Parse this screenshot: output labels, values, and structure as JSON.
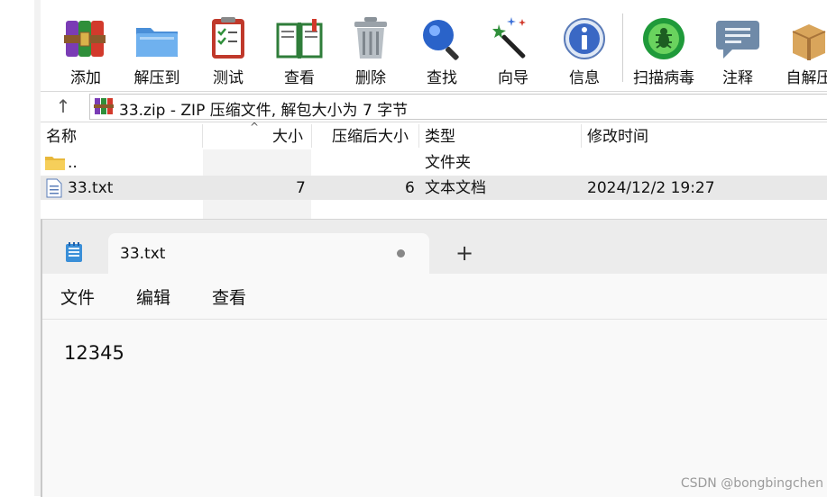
{
  "winrar": {
    "toolbar": [
      {
        "label": "添加",
        "icon": "add-archive-icon"
      },
      {
        "label": "解压到",
        "icon": "extract-to-icon"
      },
      {
        "label": "测试",
        "icon": "test-icon"
      },
      {
        "label": "查看",
        "icon": "view-icon"
      },
      {
        "label": "删除",
        "icon": "delete-icon"
      },
      {
        "label": "查找",
        "icon": "find-icon"
      },
      {
        "label": "向导",
        "icon": "wizard-icon"
      },
      {
        "label": "信息",
        "icon": "info-icon"
      },
      {
        "label": "扫描病毒",
        "icon": "virus-scan-icon"
      },
      {
        "label": "注释",
        "icon": "comment-icon"
      },
      {
        "label": "自解压",
        "icon": "sfx-icon"
      }
    ],
    "path_text": "33.zip - ZIP 压缩文件, 解包大小为 7 字节",
    "columns": {
      "name": "名称",
      "size": "大小",
      "packed": "压缩后大小",
      "type": "类型",
      "modified": "修改时间"
    },
    "rows": [
      {
        "name": "..",
        "size": "",
        "packed": "",
        "type": "文件夹",
        "modified": ""
      },
      {
        "name": "33.txt",
        "size": "7",
        "packed": "6",
        "type": "文本文档",
        "modified": "2024/12/2 19:27"
      }
    ]
  },
  "notepad": {
    "tab_title": "33.txt",
    "plus": "+",
    "menu": {
      "file": "文件",
      "edit": "编辑",
      "view": "查看"
    },
    "content": "12345"
  },
  "watermark": "CSDN @bongbingchen"
}
